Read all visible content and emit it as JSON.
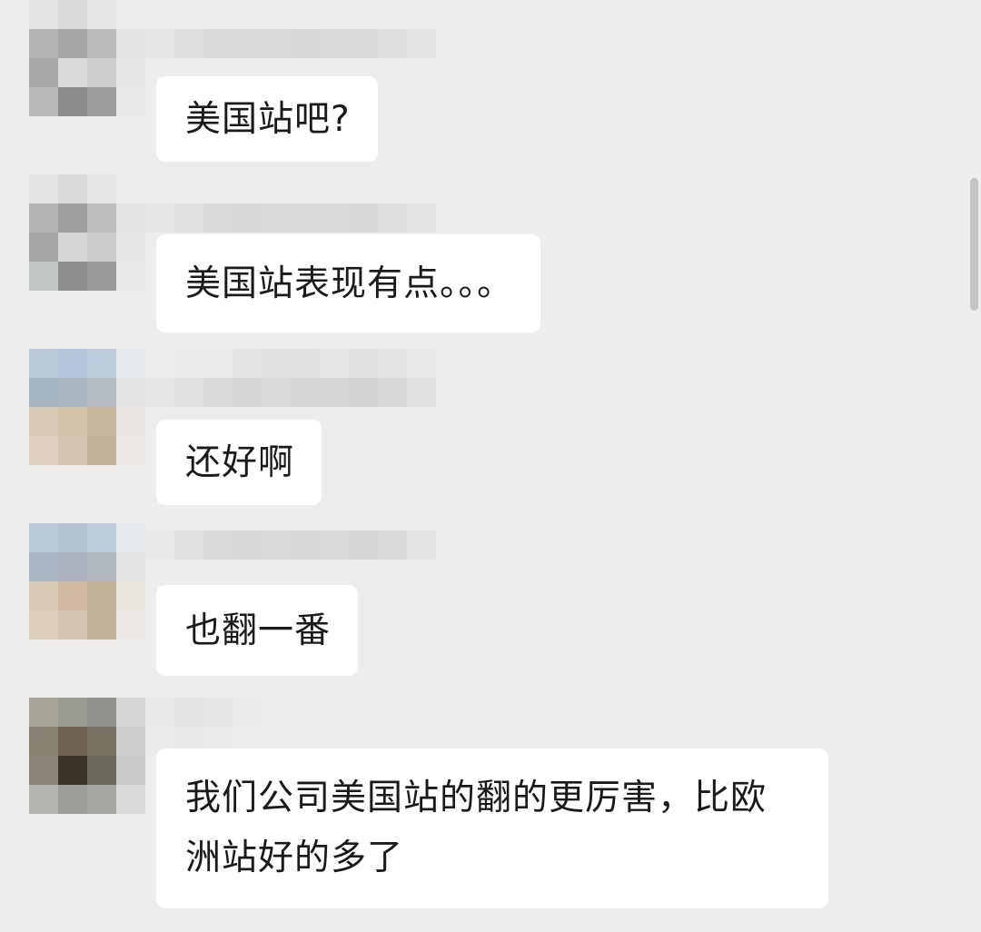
{
  "chat": {
    "messages": [
      {
        "text": "美国站吧?"
      },
      {
        "text": "美国站表现有点。。。"
      },
      {
        "text": "还好啊"
      },
      {
        "text": "也翻一番"
      },
      {
        "text": "我们公司美国站的翻的更厉害，比欧洲站好的多了"
      }
    ]
  },
  "colors": {
    "background": "#ededed",
    "bubble": "#ffffff",
    "text": "#1a1a1a",
    "scrollbar": "#c4c4c4"
  },
  "icons": {
    "avatar": "pixelated-avatar",
    "nickname": "pixelated-nickname"
  }
}
